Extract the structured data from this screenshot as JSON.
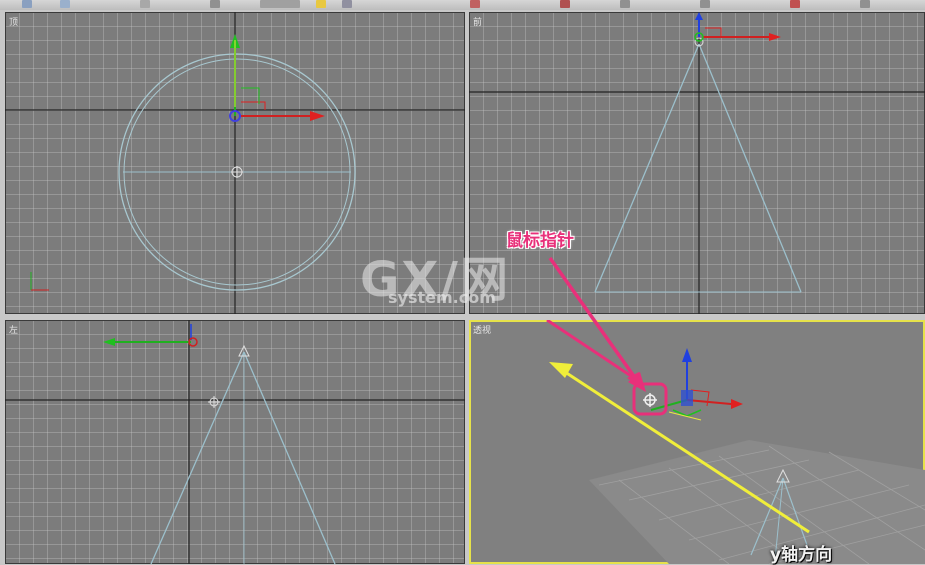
{
  "viewports": {
    "top": {
      "label": "顶"
    },
    "front": {
      "label": "前"
    },
    "left": {
      "label": "左"
    },
    "perspective": {
      "label": "透视"
    }
  },
  "annotations": {
    "pointer_label": "鼠标指针",
    "axis_label": "y轴方向"
  },
  "watermark": {
    "main": "GX/网",
    "sub": "system.com"
  },
  "colors": {
    "viewport_bg": "#7c7c7c",
    "active_border": "#e6e24a",
    "annotation_pink": "#e8307a",
    "arrow_yellow": "#f0ee3a",
    "axis_x": "#e02020",
    "axis_y": "#20c020",
    "axis_z": "#2040e0"
  }
}
